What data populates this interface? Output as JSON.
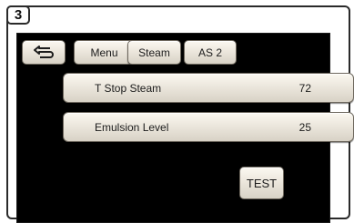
{
  "step": "3",
  "toolbar": {
    "back_icon": "back-arrow-icon",
    "tabs": [
      {
        "label": "Menu"
      },
      {
        "label": "Steam"
      },
      {
        "label": "AS 2"
      }
    ]
  },
  "params": [
    {
      "label": "T Stop Steam",
      "value": "72"
    },
    {
      "label": "Emulsion Level",
      "value": "25"
    }
  ],
  "test_button": {
    "label": "TEST"
  },
  "colors": {
    "screen_bg": "#000000",
    "button_face": "#ece7dd",
    "frame": "#2a2a2a"
  }
}
